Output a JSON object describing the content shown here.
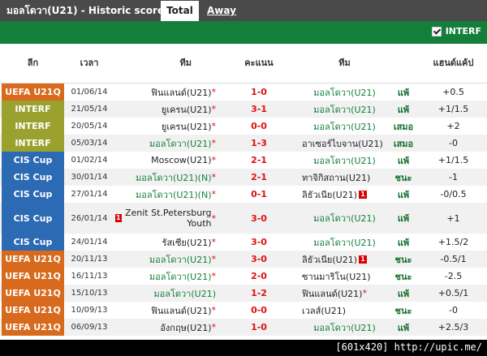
{
  "header": {
    "title": "มอลโดวา(U21) - Historic scores",
    "tab_total": "Total",
    "tab_away": "Away",
    "filter_label": "INTERF"
  },
  "columns": {
    "league": "ลีก",
    "time": "เวลา",
    "home": "ทีม",
    "score": "คะแนน",
    "away": "ทีม",
    "handicap": "แฮนด์แค้ป"
  },
  "colors": {
    "uefa": "#d86a1d",
    "interf": "#9aa12f",
    "cis": "#2d6ab4",
    "green": "#137f3b",
    "red": "#dd1111"
  },
  "rows": [
    {
      "comp": "UEFA U21Q",
      "type": "uefa",
      "date": "01/06/14",
      "home": "ฟินแลนด์(U21)",
      "home_star": "*",
      "score": "1-0",
      "away": "มอลโดวา(U21)",
      "res": "แพ้",
      "hcap": "+0.5"
    },
    {
      "comp": "INTERF",
      "type": "interf",
      "date": "21/05/14",
      "home": "ยูเครน(U21)",
      "home_star": "*",
      "score": "3-1",
      "away": "มอลโดวา(U21)",
      "res": "แพ้",
      "hcap": "+1/1.5"
    },
    {
      "comp": "INTERF",
      "type": "interf",
      "date": "20/05/14",
      "home": "ยูเครน(U21)",
      "home_star": "*",
      "score": "0-0",
      "away": "มอลโดวา(U21)",
      "res": "เสมอ",
      "hcap": "+2"
    },
    {
      "comp": "INTERF",
      "type": "interf",
      "date": "05/03/14",
      "home": "มอลโดวา(U21)",
      "home_star": "*",
      "score": "1-3",
      "away": "อาเซอร์ไบจาน(U21)",
      "res": "เสมอ",
      "hcap": "-0"
    },
    {
      "comp": "CIS Cup",
      "type": "cis",
      "date": "01/02/14",
      "home": "Moscow(U21)",
      "home_star": "*",
      "score": "2-1",
      "away": "มอลโดวา(U21)",
      "res": "แพ้",
      "hcap": "+1/1.5"
    },
    {
      "comp": "CIS Cup",
      "type": "cis",
      "date": "30/01/14",
      "home": "มอลโดวา(U21)(N)",
      "home_star": "*",
      "score": "2-1",
      "away": "ทาจิกิสถาน(U21)",
      "res": "ชนะ",
      "hcap": "-1"
    },
    {
      "comp": "CIS Cup",
      "type": "cis",
      "date": "27/01/14",
      "home": "มอลโดวา(U21)(N)",
      "home_star": "*",
      "score": "0-1",
      "away": "ลิธัวเนีย(U21)",
      "res": "แพ้",
      "hcap": "-0/0.5",
      "away_card": "1"
    },
    {
      "comp": "CIS Cup",
      "type": "cis",
      "date": "26/01/14",
      "home": "Zenit St.Petersburg Youth",
      "home_star": "*",
      "score": "3-0",
      "away": "มอลโดวา(U21)",
      "res": "แพ้",
      "hcap": "+1",
      "home_card": "1"
    },
    {
      "comp": "CIS Cup",
      "type": "cis",
      "date": "24/01/14",
      "home": "รัสเซีย(U21)",
      "home_star": "*",
      "score": "3-0",
      "away": "มอลโดวา(U21)",
      "res": "แพ้",
      "hcap": "+1.5/2"
    },
    {
      "comp": "UEFA U21Q",
      "type": "uefa",
      "date": "20/11/13",
      "home": "มอลโดวา(U21)",
      "home_star": "*",
      "score": "3-0",
      "away": "ลิธัวเนีย(U21)",
      "res": "ชนะ",
      "hcap": "-0.5/1",
      "away_card": "1"
    },
    {
      "comp": "UEFA U21Q",
      "type": "uefa",
      "date": "16/11/13",
      "home": "มอลโดวา(U21)",
      "home_star": "*",
      "score": "2-0",
      "away": "ซานมาริโน(U21)",
      "res": "ชนะ",
      "hcap": "-2.5"
    },
    {
      "comp": "UEFA U21Q",
      "type": "uefa",
      "date": "15/10/13",
      "home": "มอลโดวา(U21)",
      "home_star": "",
      "score": "1-2",
      "away": "ฟินแลนด์(U21)",
      "res": "แพ้",
      "hcap": "+0.5/1",
      "away_star": "*"
    },
    {
      "comp": "UEFA U21Q",
      "type": "uefa",
      "date": "10/09/13",
      "home": "ฟินแลนด์(U21)",
      "home_star": "*",
      "score": "0-0",
      "away": "เวลส์(U21)",
      "res": "ชนะ",
      "hcap": "-0"
    },
    {
      "comp": "UEFA U21Q",
      "type": "uefa",
      "date": "06/09/13",
      "home": "อังกฤษ(U21)",
      "home_star": "*",
      "score": "1-0",
      "away": "มอลโดวา(U21)",
      "res": "แพ้",
      "hcap": "+2.5/3"
    }
  ],
  "footer": {
    "text": "[601x420] http://upic.me/"
  }
}
